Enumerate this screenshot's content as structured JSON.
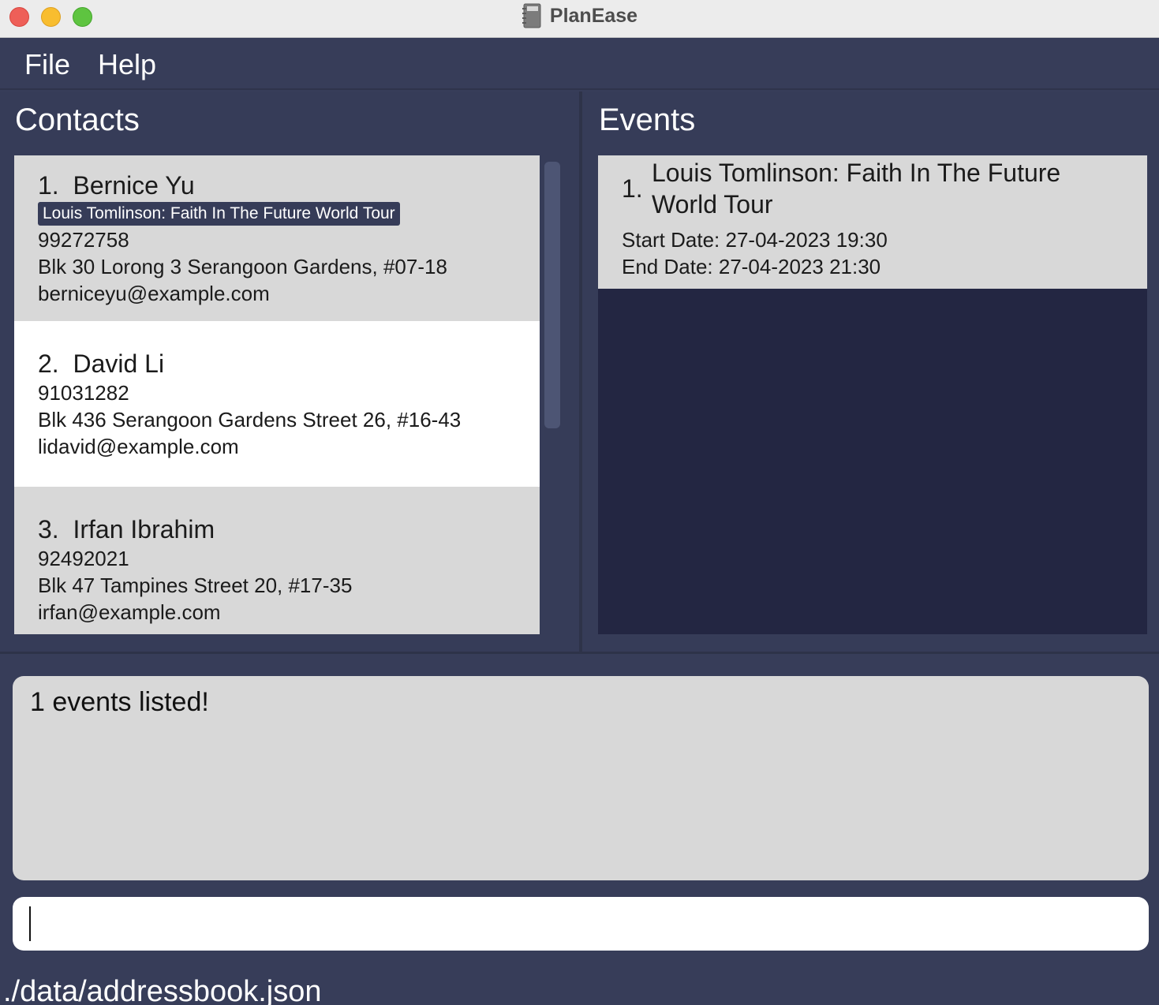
{
  "window": {
    "title": "PlanEase"
  },
  "menu": {
    "file": "File",
    "help": "Help"
  },
  "contacts": {
    "title": "Contacts",
    "items": [
      {
        "index": "1.",
        "name": "Bernice Yu",
        "tag": "Louis Tomlinson: Faith In The Future World Tour",
        "phone": "99272758",
        "address": "Blk 30 Lorong 3 Serangoon Gardens, #07-18",
        "email": "berniceyu@example.com"
      },
      {
        "index": "2.",
        "name": "David Li",
        "phone": "91031282",
        "address": "Blk 436 Serangoon Gardens Street 26, #16-43",
        "email": "lidavid@example.com"
      },
      {
        "index": "3.",
        "name": "Irfan Ibrahim",
        "phone": "92492021",
        "address": "Blk 47 Tampines Street 20, #17-35",
        "email": "irfan@example.com"
      }
    ]
  },
  "events": {
    "title": "Events",
    "items": [
      {
        "index": "1.",
        "name": "Louis Tomlinson: Faith In The Future World Tour",
        "start": "Start Date: 27-04-2023 19:30",
        "end": "End Date: 27-04-2023 21:30"
      }
    ]
  },
  "result": {
    "text": "1 events listed!"
  },
  "command": {
    "value": "",
    "placeholder": ""
  },
  "status": {
    "path": "./data/addressbook.json"
  },
  "colors": {
    "background": "#373d59",
    "events_empty": "#232642",
    "card": "#d8d8d8",
    "card_selected": "#ffffff",
    "tag": "#363c58"
  }
}
